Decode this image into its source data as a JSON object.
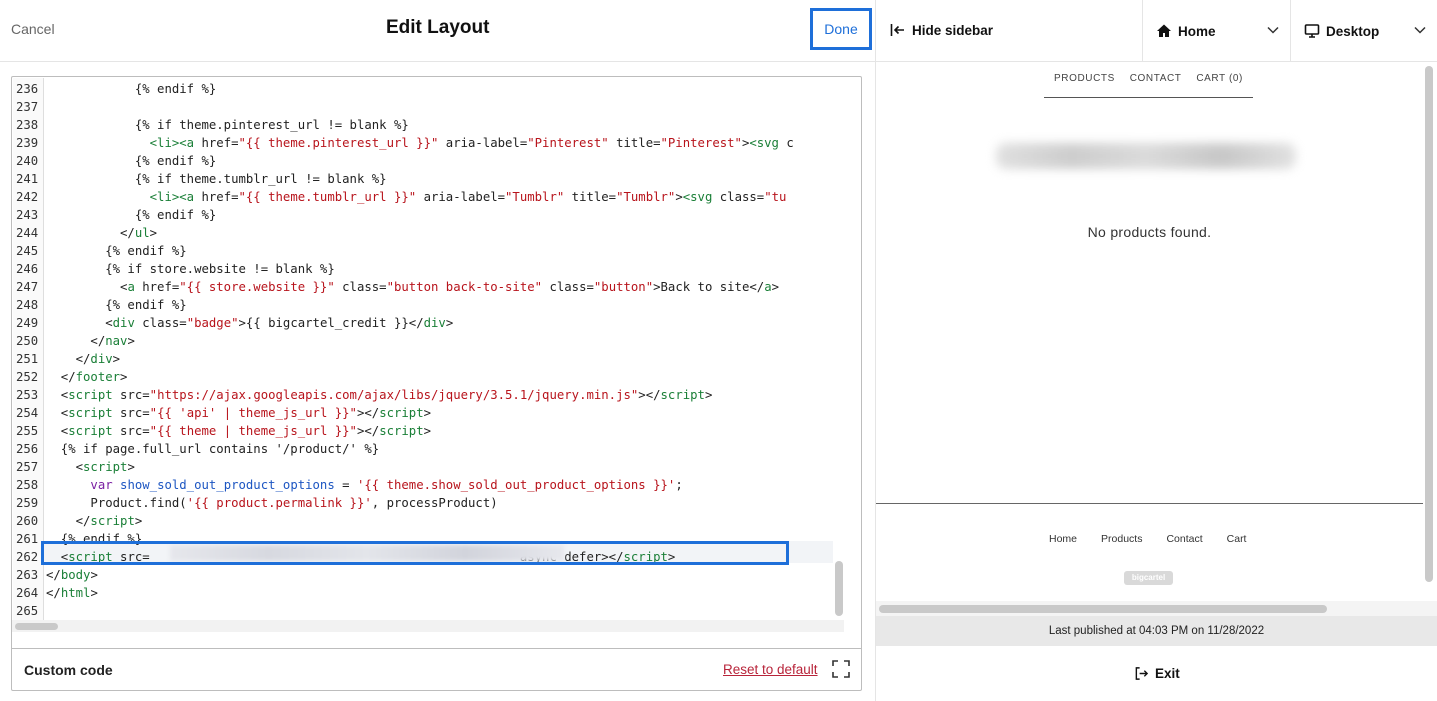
{
  "editor": {
    "cancel_label": "Cancel",
    "title": "Edit Layout",
    "done_label": "Done",
    "footer_label": "Custom code",
    "reset_label": "Reset to default",
    "code_lines": [
      {
        "num": "236",
        "html": "            {% endif %}"
      },
      {
        "num": "237",
        "html": ""
      },
      {
        "num": "238",
        "html": "            {% if theme.pinterest_url != blank %}"
      },
      {
        "num": "239",
        "html": "              <span class=\"tag\">&lt;li&gt;&lt;a</span> href=<span class=\"str\">\"{{ theme.pinterest_url }}\"</span> aria-label=<span class=\"str\">\"Pinterest\"</span> title=<span class=\"str\">\"Pinterest\"</span>&gt;<span class=\"tag\">&lt;svg</span> c"
      },
      {
        "num": "240",
        "html": "            {% endif %}"
      },
      {
        "num": "241",
        "html": "            {% if theme.tumblr_url != blank %}"
      },
      {
        "num": "242",
        "html": "              <span class=\"tag\">&lt;li&gt;&lt;a</span> href=<span class=\"str\">\"{{ theme.tumblr_url }}\"</span> aria-label=<span class=\"str\">\"Tumblr\"</span> title=<span class=\"str\">\"Tumblr\"</span>&gt;<span class=\"tag\">&lt;svg</span> class=<span class=\"str\">\"tu</span>"
      },
      {
        "num": "243",
        "html": "            {% endif %}"
      },
      {
        "num": "244",
        "html": "          &lt;/<span class=\"tag\">ul</span>&gt;"
      },
      {
        "num": "245",
        "html": "        {% endif %}"
      },
      {
        "num": "246",
        "html": "        {% if store.website != blank %}"
      },
      {
        "num": "247",
        "html": "          &lt;<span class=\"tag\">a</span> href=<span class=\"str\">\"{{ store.website }}\"</span> class=<span class=\"str\">\"button back-to-site\"</span> class=<span class=\"str\">\"button\"</span>&gt;Back to site&lt;/<span class=\"tag\">a</span>&gt;"
      },
      {
        "num": "248",
        "html": "        {% endif %}"
      },
      {
        "num": "249",
        "html": "        &lt;<span class=\"tag\">div</span> class=<span class=\"str\">\"badge\"</span>&gt;{{ bigcartel_credit }}&lt;/<span class=\"tag\">div</span>&gt;"
      },
      {
        "num": "250",
        "html": "      &lt;/<span class=\"tag\">nav</span>&gt;"
      },
      {
        "num": "251",
        "html": "    &lt;/<span class=\"tag\">div</span>&gt;"
      },
      {
        "num": "252",
        "html": "  &lt;/<span class=\"tag\">footer</span>&gt;"
      },
      {
        "num": "253",
        "html": "  &lt;<span class=\"tag\">script</span> src=<span class=\"str\">\"https://ajax.googleapis.com/ajax/libs/jquery/3.5.1/jquery.min.js\"</span>&gt;&lt;/<span class=\"tag\">script</span>&gt;"
      },
      {
        "num": "254",
        "html": "  &lt;<span class=\"tag\">script</span> src=<span class=\"str\">\"{{ 'api' | theme_js_url }}\"</span>&gt;&lt;/<span class=\"tag\">script</span>&gt;"
      },
      {
        "num": "255",
        "html": "  &lt;<span class=\"tag\">script</span> src=<span class=\"str\">\"{{ theme | theme_js_url }}\"</span>&gt;&lt;/<span class=\"tag\">script</span>&gt;"
      },
      {
        "num": "256",
        "html": "  {% if page.full_url contains '/product/' %}"
      },
      {
        "num": "257",
        "html": "    &lt;<span class=\"tag\">script</span>&gt;"
      },
      {
        "num": "258",
        "html": "      <span class=\"kw\">var</span> <span class=\"var\">show_sold_out_product_options</span> = <span class=\"str\">'{{ theme.show_sold_out_product_options }}'</span>;"
      },
      {
        "num": "259",
        "html": "      Product.find(<span class=\"str\">'{{ product.permalink }}'</span>, processProduct)"
      },
      {
        "num": "260",
        "html": "    &lt;/<span class=\"tag\">script</span>&gt;"
      },
      {
        "num": "261",
        "html": "  {% endif %}"
      },
      {
        "num": "262",
        "html": "  &lt;<span class=\"tag\">script</span> src=                                                  async defer&gt;&lt;/<span class=\"tag\">script</span>&gt;"
      },
      {
        "num": "263",
        "html": "&lt;/<span class=\"tag\">body</span>&gt;"
      },
      {
        "num": "264",
        "html": "&lt;/<span class=\"tag\">html</span>&gt;"
      },
      {
        "num": "265",
        "html": ""
      }
    ]
  },
  "sidebar": {
    "hide_label": "Hide sidebar",
    "page_select": {
      "value": "Home",
      "icon": "home-icon"
    },
    "device_select": {
      "value": "Desktop",
      "icon": "desktop-icon"
    }
  },
  "preview": {
    "nav": [
      "PRODUCTS",
      "CONTACT",
      "CART (0)"
    ],
    "message": "No products found.",
    "footer_links": [
      "Home",
      "Products",
      "Contact",
      "Cart"
    ],
    "badge": "bigcartel"
  },
  "status": {
    "published": "Last published at 04:03 PM on 11/28/2022",
    "exit_label": "Exit"
  },
  "colors": {
    "accent": "#1e6fd9",
    "reset_link": "#b8243a",
    "code_tag": "#1a7f37",
    "code_string": "#b8141c"
  }
}
